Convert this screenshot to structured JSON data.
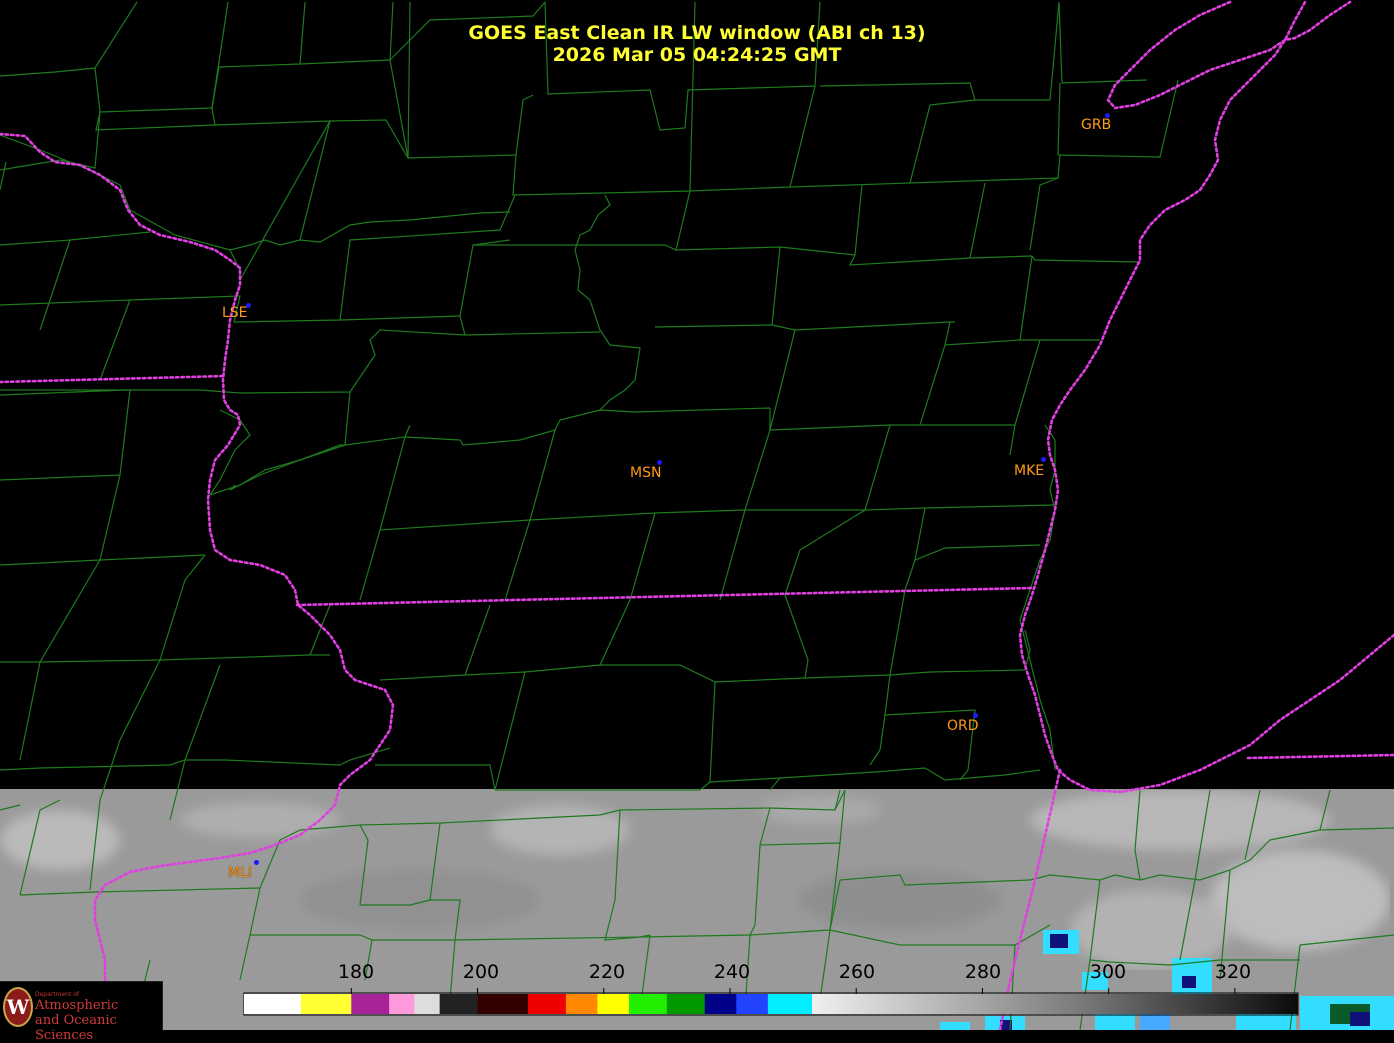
{
  "header": {
    "title_line1": "GOES East Clean IR LW window (ABI ch 13)",
    "title_line2": "2026 Mar 05  04:24:25 GMT"
  },
  "cities": [
    {
      "code": "GRB"
    },
    {
      "code": "LSE"
    },
    {
      "code": "MSN"
    },
    {
      "code": "MKE"
    },
    {
      "code": "ORD"
    },
    {
      "code": "MLI"
    }
  ],
  "colorbar": {
    "unit_values": [
      180,
      200,
      220,
      240,
      260,
      280,
      300,
      320
    ],
    "tick_labels": [
      "180",
      "200",
      "220",
      "240",
      "260",
      "280",
      "300",
      "320"
    ],
    "range": [
      163,
      330
    ],
    "segments": [
      {
        "from": 163,
        "to": 172,
        "color": "#ffffff"
      },
      {
        "from": 172,
        "to": 180,
        "color": "#ffff33"
      },
      {
        "from": 180,
        "to": 186,
        "color": "#aa2299"
      },
      {
        "from": 186,
        "to": 190,
        "color": "#ff99dd"
      },
      {
        "from": 190,
        "to": 194,
        "color": "#dddddd"
      },
      {
        "from": 194,
        "to": 200,
        "color": "#222222"
      },
      {
        "from": 200,
        "to": 208,
        "color": "#330000"
      },
      {
        "from": 208,
        "to": 214,
        "color": "#ee0000"
      },
      {
        "from": 214,
        "to": 219,
        "color": "#ff8800"
      },
      {
        "from": 219,
        "to": 224,
        "color": "#ffff00"
      },
      {
        "from": 224,
        "to": 230,
        "color": "#22ee00"
      },
      {
        "from": 230,
        "to": 236,
        "color": "#009900"
      },
      {
        "from": 236,
        "to": 241,
        "color": "#000088"
      },
      {
        "from": 241,
        "to": 246,
        "color": "#2244ff"
      },
      {
        "from": 246,
        "to": 253,
        "color": "#00eeff"
      },
      {
        "from": 253,
        "to": 330,
        "color": "#f0f0f0"
      }
    ]
  },
  "colors": {
    "county_border": "#1e7a1e",
    "state_border": "#e040e0",
    "city_label": "#ff9a1a",
    "title": "#ffff33",
    "cloud": "#9a9a9a"
  },
  "logo": {
    "small_text": "Department of",
    "line1": "Atmospheric",
    "line2": "and Oceanic Sciences",
    "seal_letter": "W"
  }
}
